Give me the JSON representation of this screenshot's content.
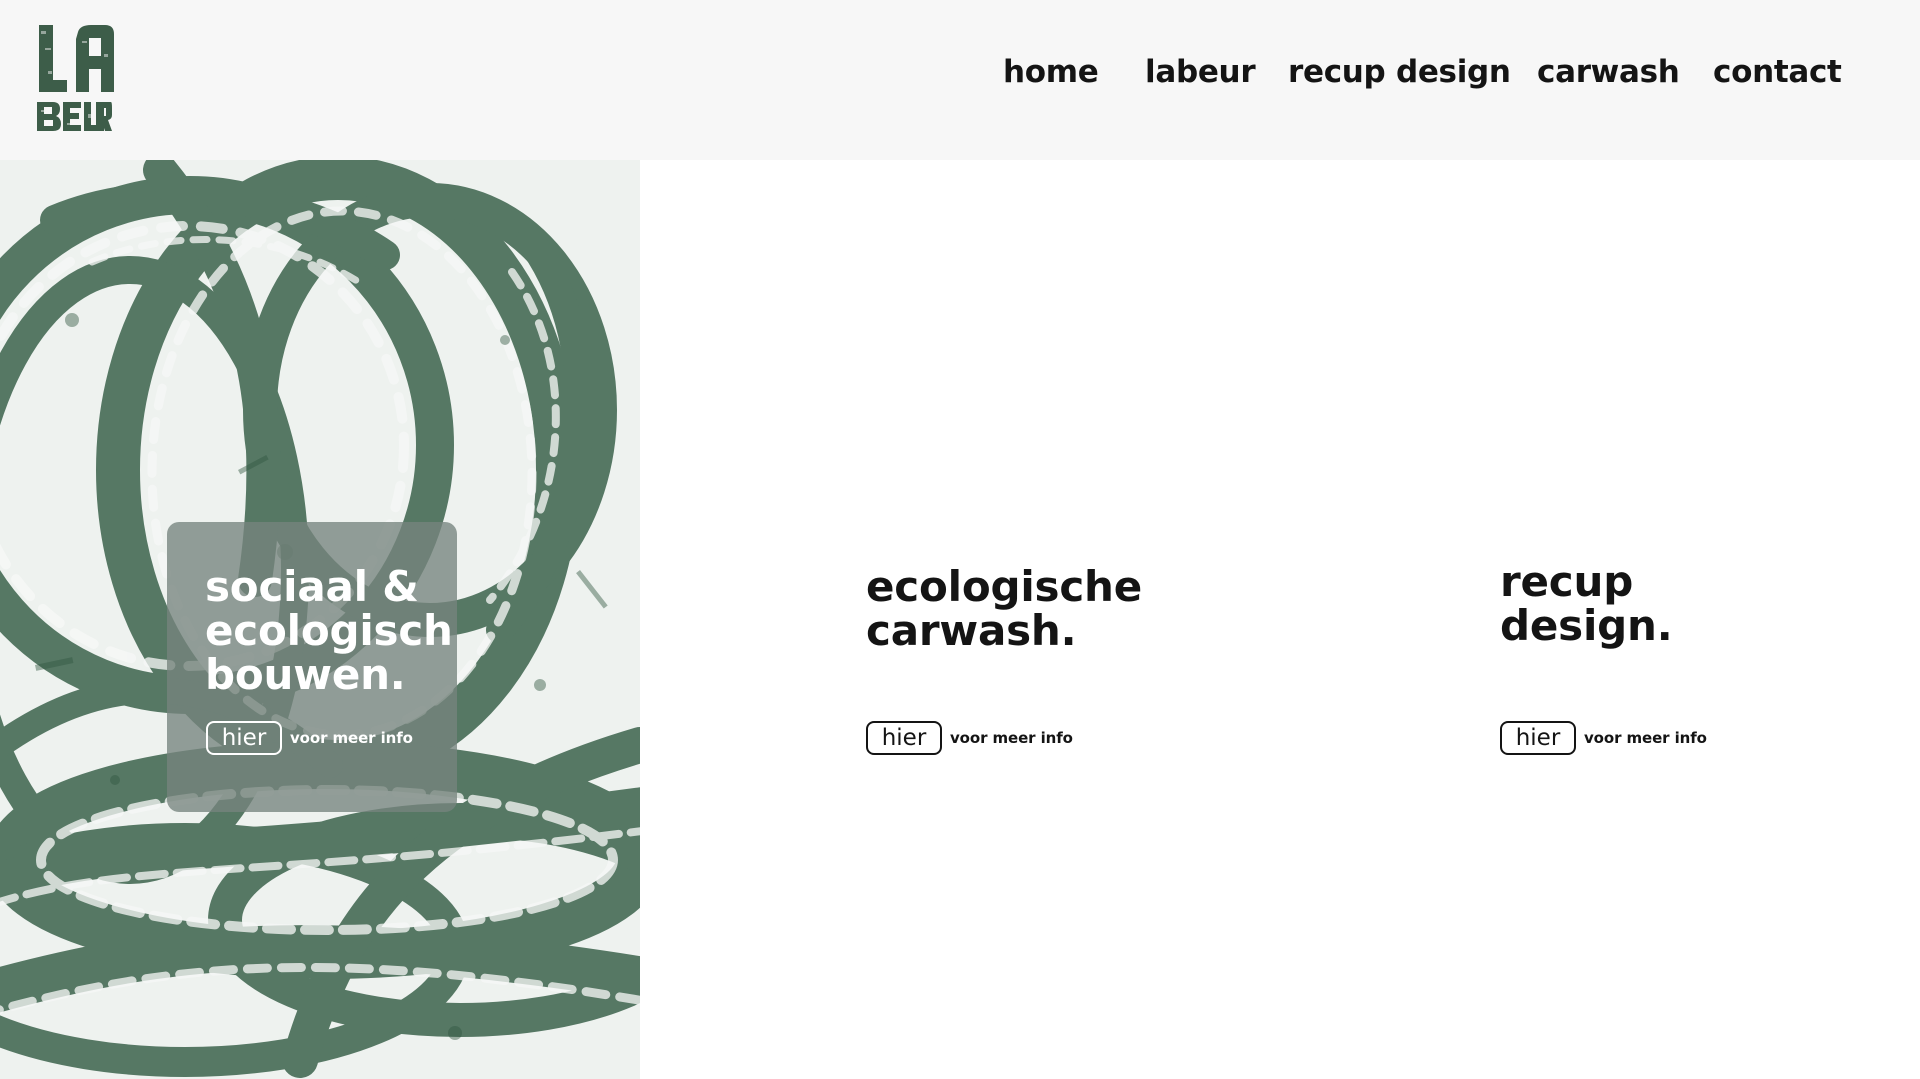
{
  "logo": {
    "text_line_1": "LA",
    "text_line_2": "BEUR"
  },
  "nav": {
    "items": [
      {
        "label": "home"
      },
      {
        "label": "labeur"
      },
      {
        "label": "recup design"
      },
      {
        "label": "carwash"
      },
      {
        "label": "contact"
      }
    ]
  },
  "hero": {
    "title_lines": [
      "sociaal &",
      "ecologisch",
      "bouwen."
    ],
    "button_label": "hier",
    "note": "voor meer info",
    "art_icon": "green-brush-stroke-art"
  },
  "features": [
    {
      "title_lines": [
        "ecologische",
        "carwash."
      ],
      "button_label": "hier",
      "note": "voor meer info"
    },
    {
      "title_lines": [
        "recup",
        "design."
      ],
      "button_label": "hier",
      "note": "voor meer info"
    }
  ],
  "colors": {
    "header_background": "#f7f7f7",
    "page_background": "#ffffff",
    "text": "#141414",
    "brand_green": "#3f6650",
    "card_overlay": "#76847d"
  }
}
